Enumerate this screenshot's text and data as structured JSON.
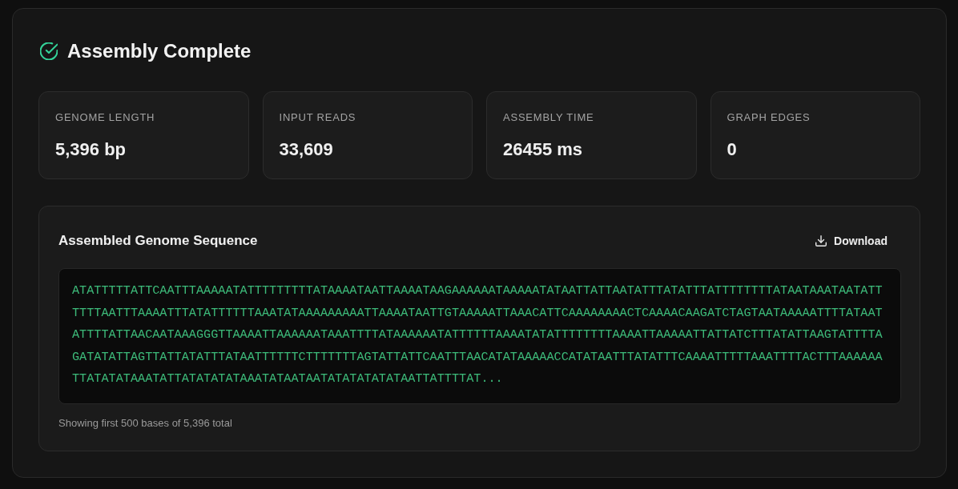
{
  "header": {
    "title": "Assembly Complete"
  },
  "stats": [
    {
      "label": "GENOME LENGTH",
      "value": "5,396 bp"
    },
    {
      "label": "INPUT READS",
      "value": "33,609"
    },
    {
      "label": "ASSEMBLY TIME",
      "value": "26455 ms"
    },
    {
      "label": "GRAPH EDGES",
      "value": "0"
    }
  ],
  "sequence_panel": {
    "title": "Assembled Genome Sequence",
    "download_button": "Download",
    "sequence": "ATATTTTTATTCAATTTAAAAATATTTTTTTTTATAAAATAATTAAAATAAGAAAAAATAAAAATATAATTATTAATATTTATATTTATTTTTTTTATAATAAATAATATTTTTTAATTTAAAATTTATATTTTTTAAATATAAAAAAAAATTAAAATAATTGTAAAAATTAAACATTCAAAAAAAACTCAAAACAAGATCTAGTAATAAAAATTTTATAATATTTTATTAACAATAAAGGGTTAAAATTAAAAAATAAATTTTATAAAAAATATTTTTTAAAATATATTTTTTTTAAAATTAAAAATTATTATCTTTATATTAAGTATTTTAGATATATTAGTTATTATATTTATAATTTTTTCTTTTTTTAGTATTATTCAATTTAACATATAAAAACCATATAATTTATATTTCAAAATTTTTAAATTTTACTTTAAAAAATTATATATAAATATTATATATATAAATATAATAATATATATATATAATTATTTTAT...",
    "footnote": "Showing first 500 bases of 5,396 total"
  }
}
